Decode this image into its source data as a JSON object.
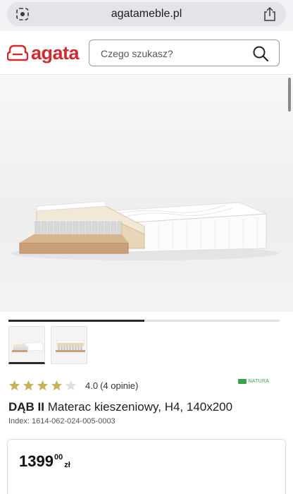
{
  "browser": {
    "url": "agatameble.pl"
  },
  "header": {
    "logo_text": "agata",
    "search_placeholder": "Czego szukasz?"
  },
  "gallery": {
    "progress_fraction": 0.5,
    "thumbnail_count": 2
  },
  "rating": {
    "stars_filled": 4,
    "stars_total": 5,
    "value": "4.0",
    "count_label": "(4 opinie)",
    "badge": "NATURA"
  },
  "product": {
    "brand": "DĄB II",
    "name": " Materac kieszeniowy, H4, 140x200",
    "index": "Index: 1614-062-024-005-0003"
  },
  "price": {
    "main": "1399",
    "cents": "00",
    "currency": "zł"
  },
  "colors": {
    "brand_red": "#d12a2f",
    "star_gold": "#c9b05a",
    "badge_green": "#3aa14b"
  }
}
